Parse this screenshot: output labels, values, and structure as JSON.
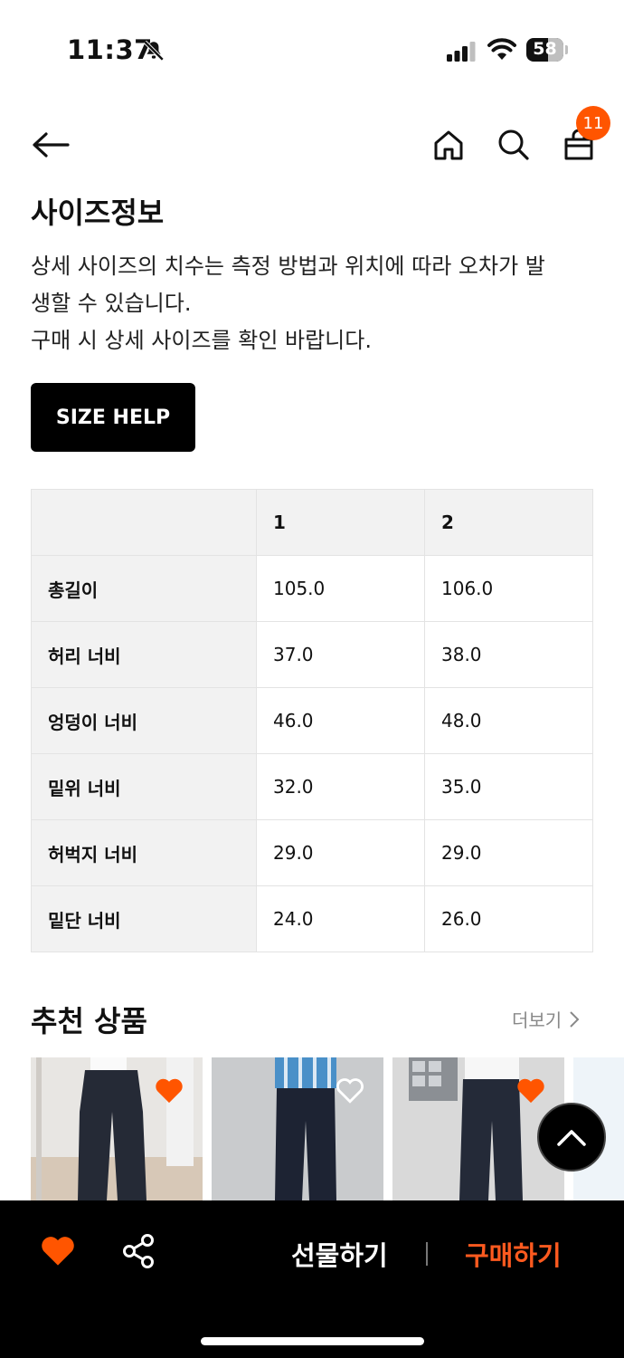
{
  "status_bar": {
    "time": "11:37",
    "battery": "58",
    "battery_level": 0.58
  },
  "nav": {
    "cart_count": "11"
  },
  "size_info": {
    "title": "사이즈정보",
    "description": [
      "상세 사이즈의 치수는 측정 방법과 위치에 따라 오차가 발",
      "생할 수 있습니다.",
      "구매 시 상세 사이즈를 확인 바랍니다."
    ],
    "help_button": "SIZE HELP",
    "table": {
      "headers": [
        "",
        "1",
        "2"
      ],
      "rows": [
        {
          "label": "총길이",
          "v1": "105.0",
          "v2": "106.0"
        },
        {
          "label": "허리 너비",
          "v1": "37.0",
          "v2": "38.0"
        },
        {
          "label": "엉덩이 너비",
          "v1": "46.0",
          "v2": "48.0"
        },
        {
          "label": "밑위 너비",
          "v1": "32.0",
          "v2": "35.0"
        },
        {
          "label": "허벅지 너비",
          "v1": "29.0",
          "v2": "29.0"
        },
        {
          "label": "밑단 너비",
          "v1": "24.0",
          "v2": "26.0"
        }
      ]
    }
  },
  "recommended": {
    "title": "추천 상품",
    "more_label": "더보기",
    "products": [
      {
        "liked": true,
        "icon": "heart-filled-icon"
      },
      {
        "liked": false,
        "icon": "heart-outline-icon"
      },
      {
        "liked": true,
        "icon": "heart-filled-icon"
      }
    ]
  },
  "bottom_bar": {
    "gift_label": "선물하기",
    "buy_label": "구매하기"
  },
  "colors": {
    "accent": "#ff5500",
    "buy": "#ff5a1f",
    "bar": "#000000"
  }
}
